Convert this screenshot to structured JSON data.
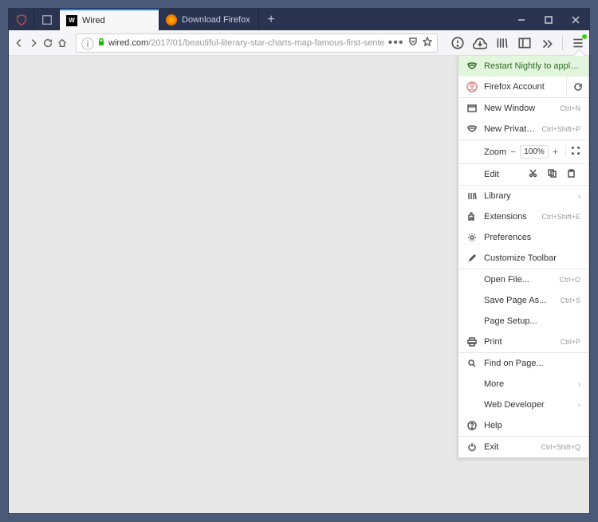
{
  "tabs": {
    "pinned1_color": "#b83d3d",
    "active_label": "Wired",
    "inactive_label": "Download Firefox"
  },
  "url": {
    "domain": "wired.com",
    "path": "/2017/01/beautiful-literary-star-charts-map-famous-first-sente"
  },
  "menu": {
    "update": "Restart Nightly to apply the update",
    "account": "Firefox Account",
    "new_window": {
      "label": "New Window",
      "shortcut": "Ctrl+N"
    },
    "new_private": {
      "label": "New Private Window",
      "shortcut": "Ctrl+Shift+P"
    },
    "zoom_label": "Zoom",
    "zoom_value": "100%",
    "edit_label": "Edit",
    "library": "Library",
    "extensions": {
      "label": "Extensions",
      "shortcut": "Ctrl+Shift+E"
    },
    "preferences": "Preferences",
    "customize": "Customize Toolbar",
    "open_file": {
      "label": "Open File...",
      "shortcut": "Ctrl+O"
    },
    "save_page": {
      "label": "Save Page As...",
      "shortcut": "Ctrl+S"
    },
    "page_setup": "Page Setup...",
    "print": {
      "label": "Print",
      "shortcut": "Ctrl+P"
    },
    "find": "Find on Page...",
    "more": "More",
    "webdev": "Web Developer",
    "help": "Help",
    "exit": {
      "label": "Exit",
      "shortcut": "Ctrl+Shift+Q"
    }
  }
}
